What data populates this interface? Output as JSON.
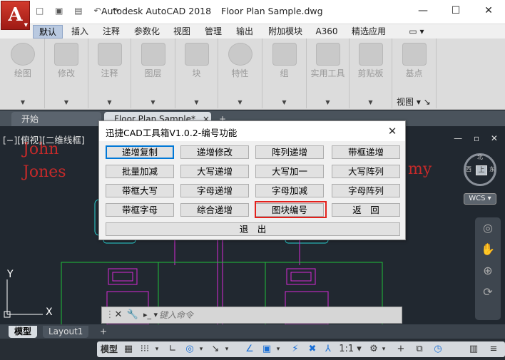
{
  "titlebar": {
    "app_name": "Autodesk AutoCAD 2018",
    "file_name": "Floor Plan Sample.dwg",
    "app_button": "A",
    "qat_icons": "□ ▣ ▤ ↶ ↷",
    "minimize": "—",
    "maximize": "☐",
    "close": "✕"
  },
  "ribbon_tabs": [
    "默认",
    "插入",
    "注释",
    "参数化",
    "视图",
    "管理",
    "输出",
    "附加模块",
    "A360",
    "精选应用"
  ],
  "ribbon_extra": "▭ ▾",
  "ribbon_panels": [
    "绘图",
    "修改",
    "注释",
    "图层",
    "块",
    "特性",
    "组",
    "实用工具",
    "剪贴板",
    "基点"
  ],
  "ribbon_view_label": "视图 ▾ ↘",
  "doc_tabs": {
    "start": "开始",
    "drawing": "Floor Plan Sample*",
    "close": "×",
    "add": "+"
  },
  "viewport": {
    "view_label": "[−][俯视][二维线框]",
    "controls": "— ▫ ✕",
    "red_texts": [
      "John",
      "Jones",
      "my"
    ],
    "viewcube_face": "上",
    "viewcube_dirs": [
      "北",
      "西",
      "东"
    ],
    "wcs": "WCS ▾",
    "ucs_y": "Y",
    "ucs_x": "X"
  },
  "dialog": {
    "title": "迅捷CAD工具箱V1.0.2-编号功能",
    "close": "✕",
    "buttons": [
      [
        "递增复制",
        "递增修改",
        "阵列递增",
        "带框递增"
      ],
      [
        "批量加减",
        "大写递增",
        "大写加一",
        "大写阵列"
      ],
      [
        "带框大写",
        "字母递增",
        "字母加减",
        "字母阵列"
      ],
      [
        "带框字母",
        "综合递增",
        "图块编号",
        "返　回"
      ]
    ],
    "exit": "退　出"
  },
  "cmdline": {
    "placeholder": "键入命令",
    "close": "✕",
    "wrench": "🔧",
    "prompt": "▸_ ▾"
  },
  "model_tabs": {
    "model": "模型",
    "layout1": "Layout1",
    "add": "+"
  },
  "statusbar": {
    "model": "模型",
    "scale": "1:1 ▾",
    "items": [
      "▦",
      "⁝⁝⁝",
      "▾",
      "∟",
      "◎",
      "▾",
      "↘",
      "▾",
      "∠",
      "▣",
      "▾",
      "⚡",
      "✖",
      "⅄",
      "1:1 ▾",
      "⚙",
      "▾",
      "+",
      "⧉",
      "◷",
      "▥",
      "≡"
    ]
  },
  "colors": {
    "highlight_box": "#e3211c",
    "viewport_bg": "#212830",
    "red_text": "#c42a2a",
    "green_lines": "#1fbf3a",
    "magenta_lines": "#d62ad6",
    "cyan_lines": "#2ad6d6"
  }
}
